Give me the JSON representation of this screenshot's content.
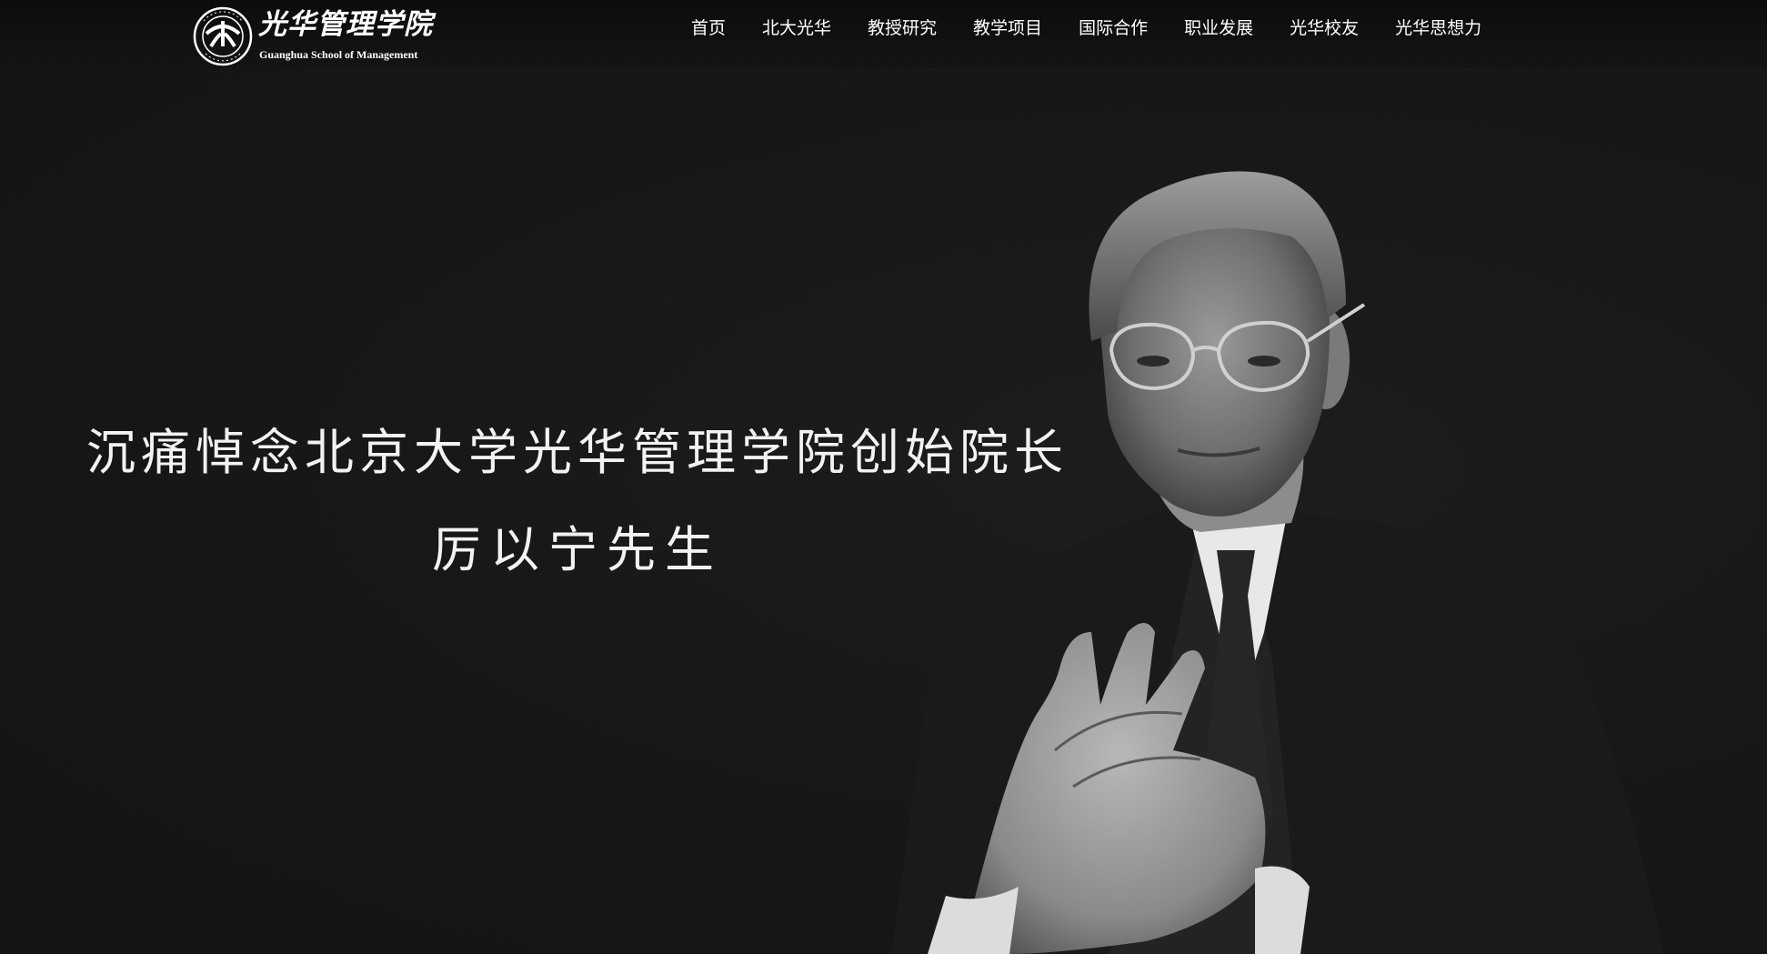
{
  "header": {
    "logo": {
      "seal_text": "PEKING UNIVERSITY 1898",
      "name_cn": "光华管理学院",
      "name_en": "Guanghua School of Management"
    },
    "nav": [
      {
        "label": "首页"
      },
      {
        "label": "北大光华"
      },
      {
        "label": "教授研究"
      },
      {
        "label": "教学项目"
      },
      {
        "label": "国际合作"
      },
      {
        "label": "职业发展"
      },
      {
        "label": "光华校友"
      },
      {
        "label": "光华思想力"
      }
    ]
  },
  "hero": {
    "title": "沉痛悼念北京大学光华管理学院创始院长",
    "name": "厉以宁先生",
    "portrait_icon": "portrait-photo"
  },
  "colors": {
    "background": "#161616",
    "header": "#0e0e0e",
    "text": "#ffffff"
  }
}
